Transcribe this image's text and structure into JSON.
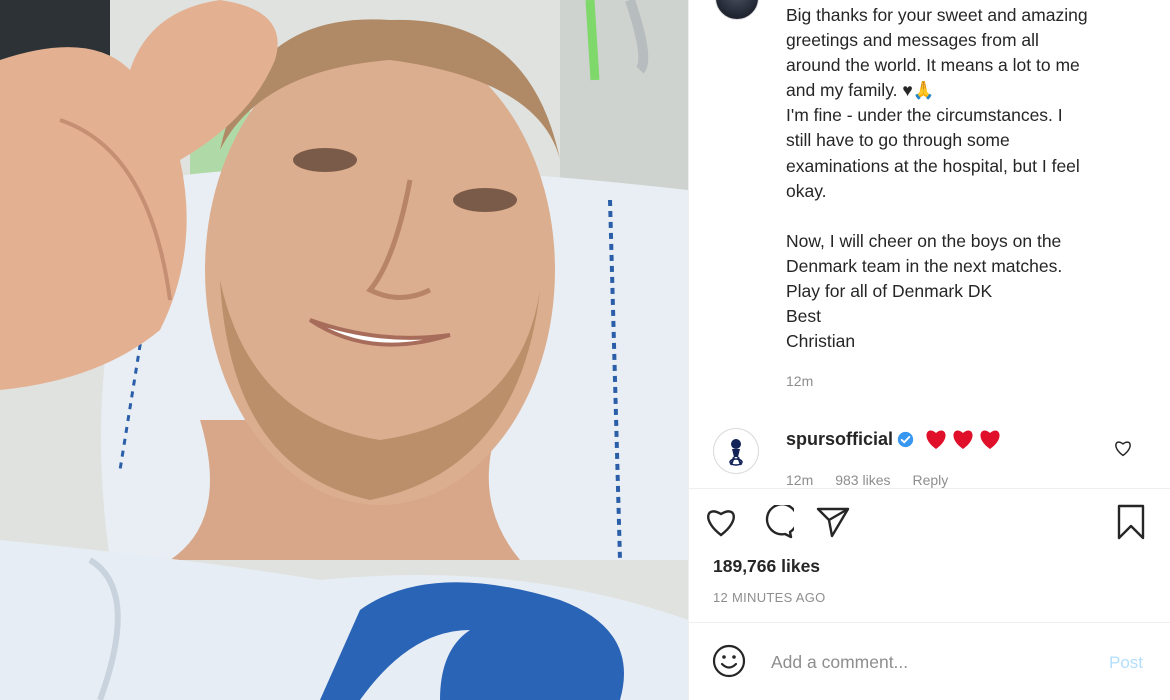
{
  "post": {
    "caption_lines": [
      "Big thanks for your sweet and amazing",
      "greetings and messages from all",
      "around the world. It means a lot to me",
      "and my family. ♥🙏",
      "I'm fine - under the circumstances. I",
      "still have to go through some",
      "examinations at the hospital, but I feel",
      "okay.",
      "",
      "Now, I will cheer on the boys on the",
      "Denmark team in the next matches.",
      "Play for all of Denmark DK",
      "Best",
      "Christian"
    ],
    "caption_time": "12m"
  },
  "comment": {
    "username": "spursofficial",
    "meta_time": "12m",
    "meta_likes": "983 likes",
    "meta_reply": "Reply"
  },
  "engagement": {
    "likes": "189,766 likes",
    "posted": "12 MINUTES AGO"
  },
  "composer": {
    "placeholder": "Add a comment...",
    "post_label": "Post"
  },
  "icons": {
    "like": "heart-outline-icon",
    "comment": "comment-bubble-icon",
    "share": "paper-plane-icon",
    "save": "bookmark-icon",
    "emoji": "smiley-icon",
    "verified": "verified-badge-icon"
  },
  "colors": {
    "text": "#262626",
    "muted": "#8e8e8e",
    "verified": "#3897f0",
    "post_disabled": "#b2dffc",
    "heart_emoji": "#e0102a"
  }
}
